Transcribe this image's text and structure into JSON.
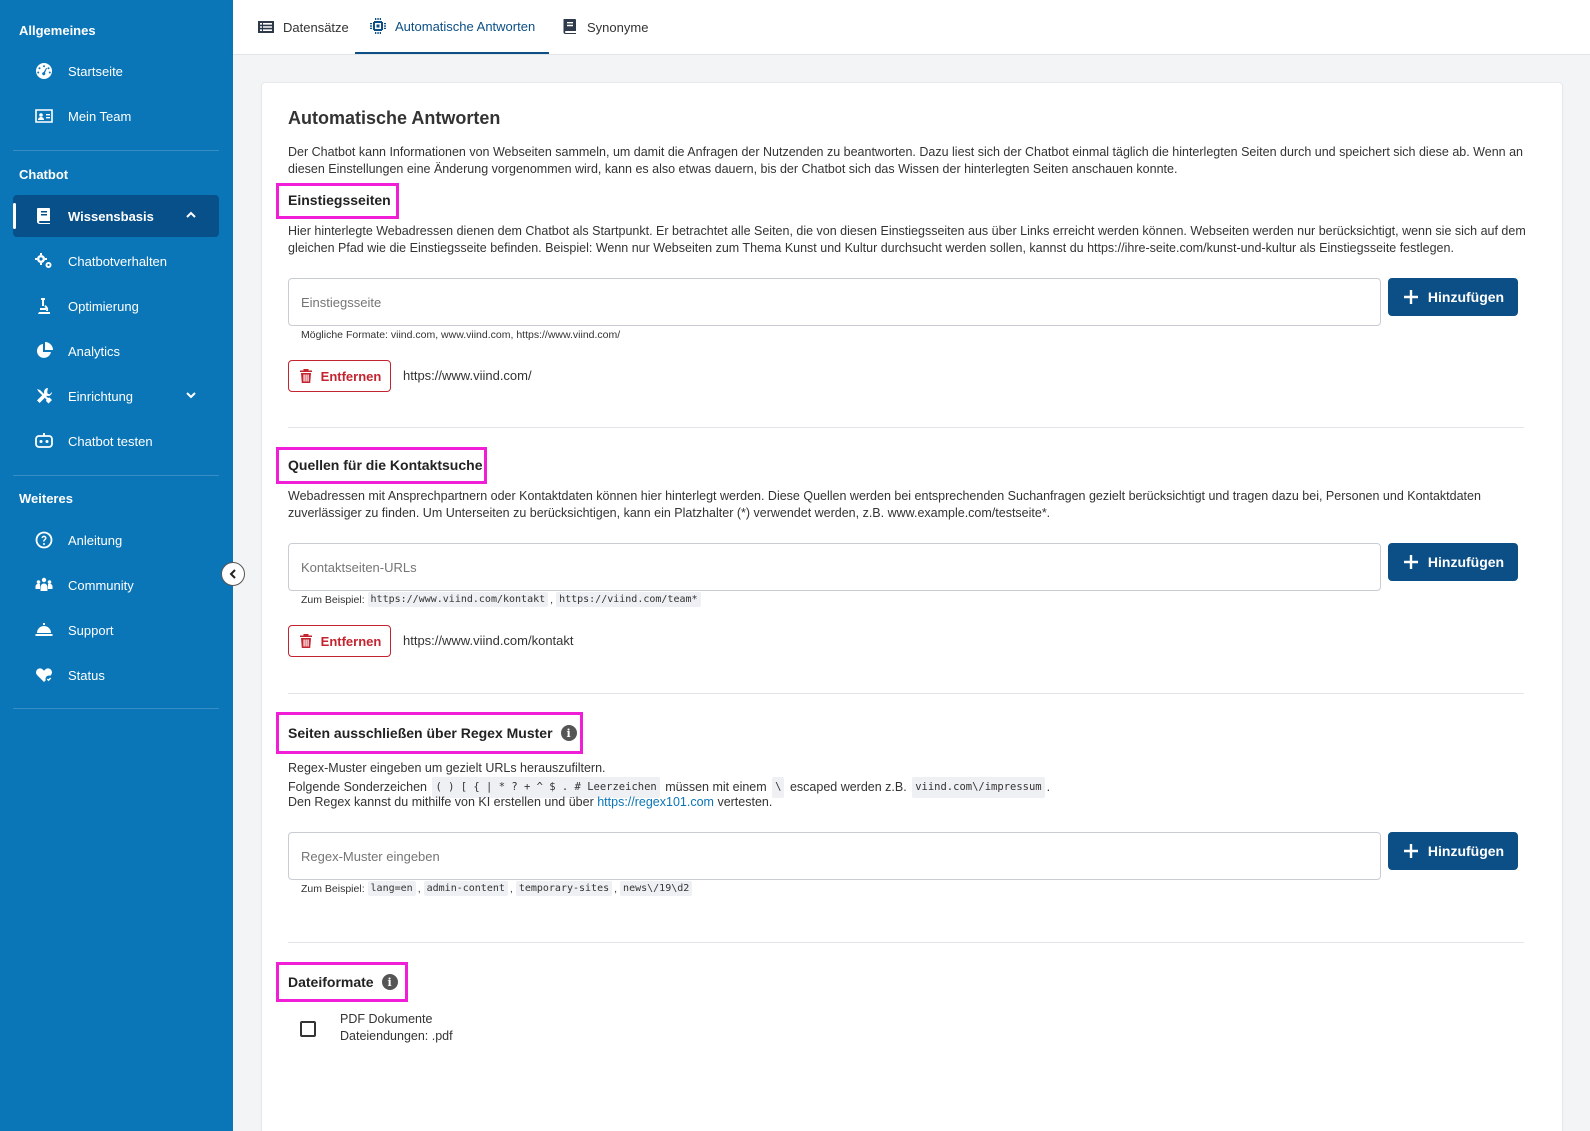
{
  "sidebar": {
    "sections": {
      "general": "Allgemeines",
      "chatbot": "Chatbot",
      "more": "Weiteres"
    },
    "items": {
      "home": "Startseite",
      "team": "Mein Team",
      "knowledge": "Wissensbasis",
      "behavior": "Chatbotverhalten",
      "optimization": "Optimierung",
      "analytics": "Analytics",
      "setup": "Einrichtung",
      "test": "Chatbot testen",
      "guide": "Anleitung",
      "community": "Community",
      "support": "Support",
      "status": "Status"
    }
  },
  "tabs": {
    "records": "Datensätze",
    "auto_answers": "Automatische Antworten",
    "synonyms": "Synonyme"
  },
  "main": {
    "title": "Automatische Antworten",
    "intro": "Der Chatbot kann Informationen von Webseiten sammeln, um damit die Anfragen der Nutzenden zu beantworten. Dazu liest sich der Chatbot einmal täglich die hinterlegten Seiten durch und speichert sich diese ab. Wenn an diesen Einstellungen eine Änderung vorgenommen wird, kann es also etwas dauern, bis der Chatbot sich das Wissen der hinterlegten Seiten anschauen konnte.",
    "entry": {
      "title": "Einstiegsseiten",
      "desc": "Hier hinterlegte Webadressen dienen dem Chatbot als Startpunkt. Er betrachtet alle Seiten, die von diesen Einstiegsseiten aus über Links erreicht werden können. Webseiten werden nur berücksichtigt, wenn sie sich auf dem gleichen Pfad wie die Einstiegsseite befinden. Beispiel: Wenn nur Webseiten zum Thema Kunst und Kultur durchsucht werden sollen, kannst du https://ihre-seite.com/kunst-und-kultur als Einstiegsseite festlegen.",
      "placeholder": "Einstiegsseite",
      "hint": "Mögliche Formate: viind.com, www.viind.com, https://www.viind.com/",
      "add": "Hinzufügen",
      "remove": "Entfernen",
      "url": "https://www.viind.com/"
    },
    "contact": {
      "title": "Quellen für die Kontaktsuche",
      "desc": "Webadressen mit Ansprechpartnern oder Kontaktdaten können hier hinterlegt werden. Diese Quellen werden bei entsprechenden Suchanfragen gezielt berücksichtigt und tragen dazu bei, Personen und Kontaktdaten zuverlässiger zu finden. Um Unterseiten zu berücksichtigen, kann ein Platzhalter (*) verwendet werden, z.B. www.example.com/testseite*.",
      "placeholder": "Kontaktseiten-URLs",
      "hint_prefix": "Zum Beispiel:",
      "examples": [
        "https://www.viind.com/kontakt",
        "https://viind.com/team*"
      ],
      "add": "Hinzufügen",
      "remove": "Entfernen",
      "url": "https://www.viind.com/kontakt"
    },
    "regex": {
      "title": "Seiten ausschließen über Regex Muster",
      "line1": "Regex-Muster eingeben um gezielt URLs herauszufiltern.",
      "line2_prefix": "Folgende Sonderzeichen",
      "special_chars": "( ) [ { | * ? + ^ $ . # Leerzeichen",
      "line2_mid": "müssen mit einem",
      "escape_char": "\\",
      "line2_mid2": "escaped werden z.B.",
      "escape_example": "viind.com\\/impressum",
      "line2_end": ".",
      "line3_prefix": "Den Regex kannst du mithilfe von KI erstellen und über",
      "line3_link": "https://regex101.com",
      "line3_suffix": "vertesten.",
      "placeholder": "Regex-Muster eingeben",
      "hint_prefix": "Zum Beispiel:",
      "examples": [
        "lang=en",
        "admin-content",
        "temporary-sites",
        "news\\/19\\d2"
      ],
      "add": "Hinzufügen"
    },
    "formats": {
      "title": "Dateiformate",
      "pdf_label": "PDF Dokumente",
      "pdf_ext": "Dateiendungen: .pdf"
    }
  },
  "colors": {
    "sidebar": "#0a76b7",
    "primary": "#0b4f86",
    "danger": "#c4242f",
    "highlight": "#f01ed6"
  }
}
